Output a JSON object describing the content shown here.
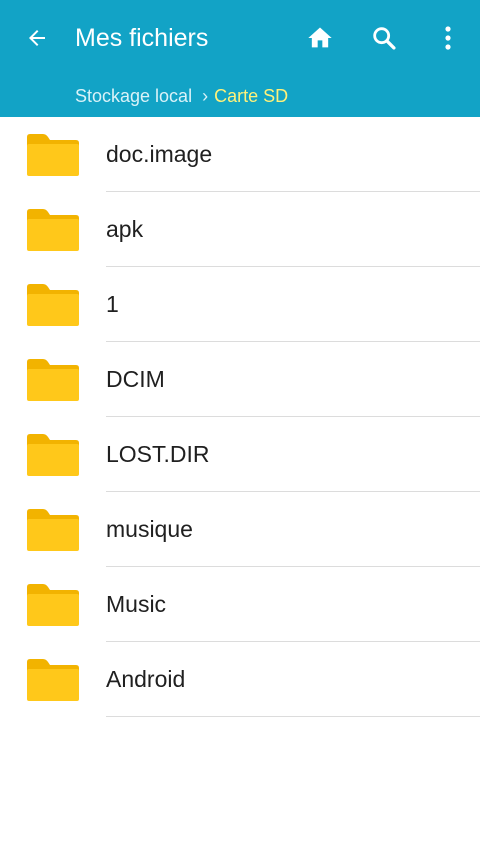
{
  "toolbar": {
    "title": "Mes fichiers",
    "back_icon": "arrow-left-icon",
    "home_icon": "home-icon",
    "search_icon": "search-icon",
    "more_icon": "more-vertical-icon"
  },
  "breadcrumb": {
    "parent": "Stockage local",
    "separator": "›",
    "current": "Carte SD"
  },
  "colors": {
    "appbar": "#12a3c6",
    "crumb_current": "#fff27a",
    "folder": "#ffc81a",
    "folder_tab": "#f2b300"
  },
  "files": [
    {
      "name": "doc.image",
      "icon": "folder-icon"
    },
    {
      "name": "apk",
      "icon": "folder-icon"
    },
    {
      "name": "1",
      "icon": "folder-icon"
    },
    {
      "name": "DCIM",
      "icon": "folder-icon"
    },
    {
      "name": "LOST.DIR",
      "icon": "folder-icon"
    },
    {
      "name": "musique",
      "icon": "folder-icon"
    },
    {
      "name": "Music",
      "icon": "folder-icon"
    },
    {
      "name": "Android",
      "icon": "folder-icon"
    }
  ]
}
